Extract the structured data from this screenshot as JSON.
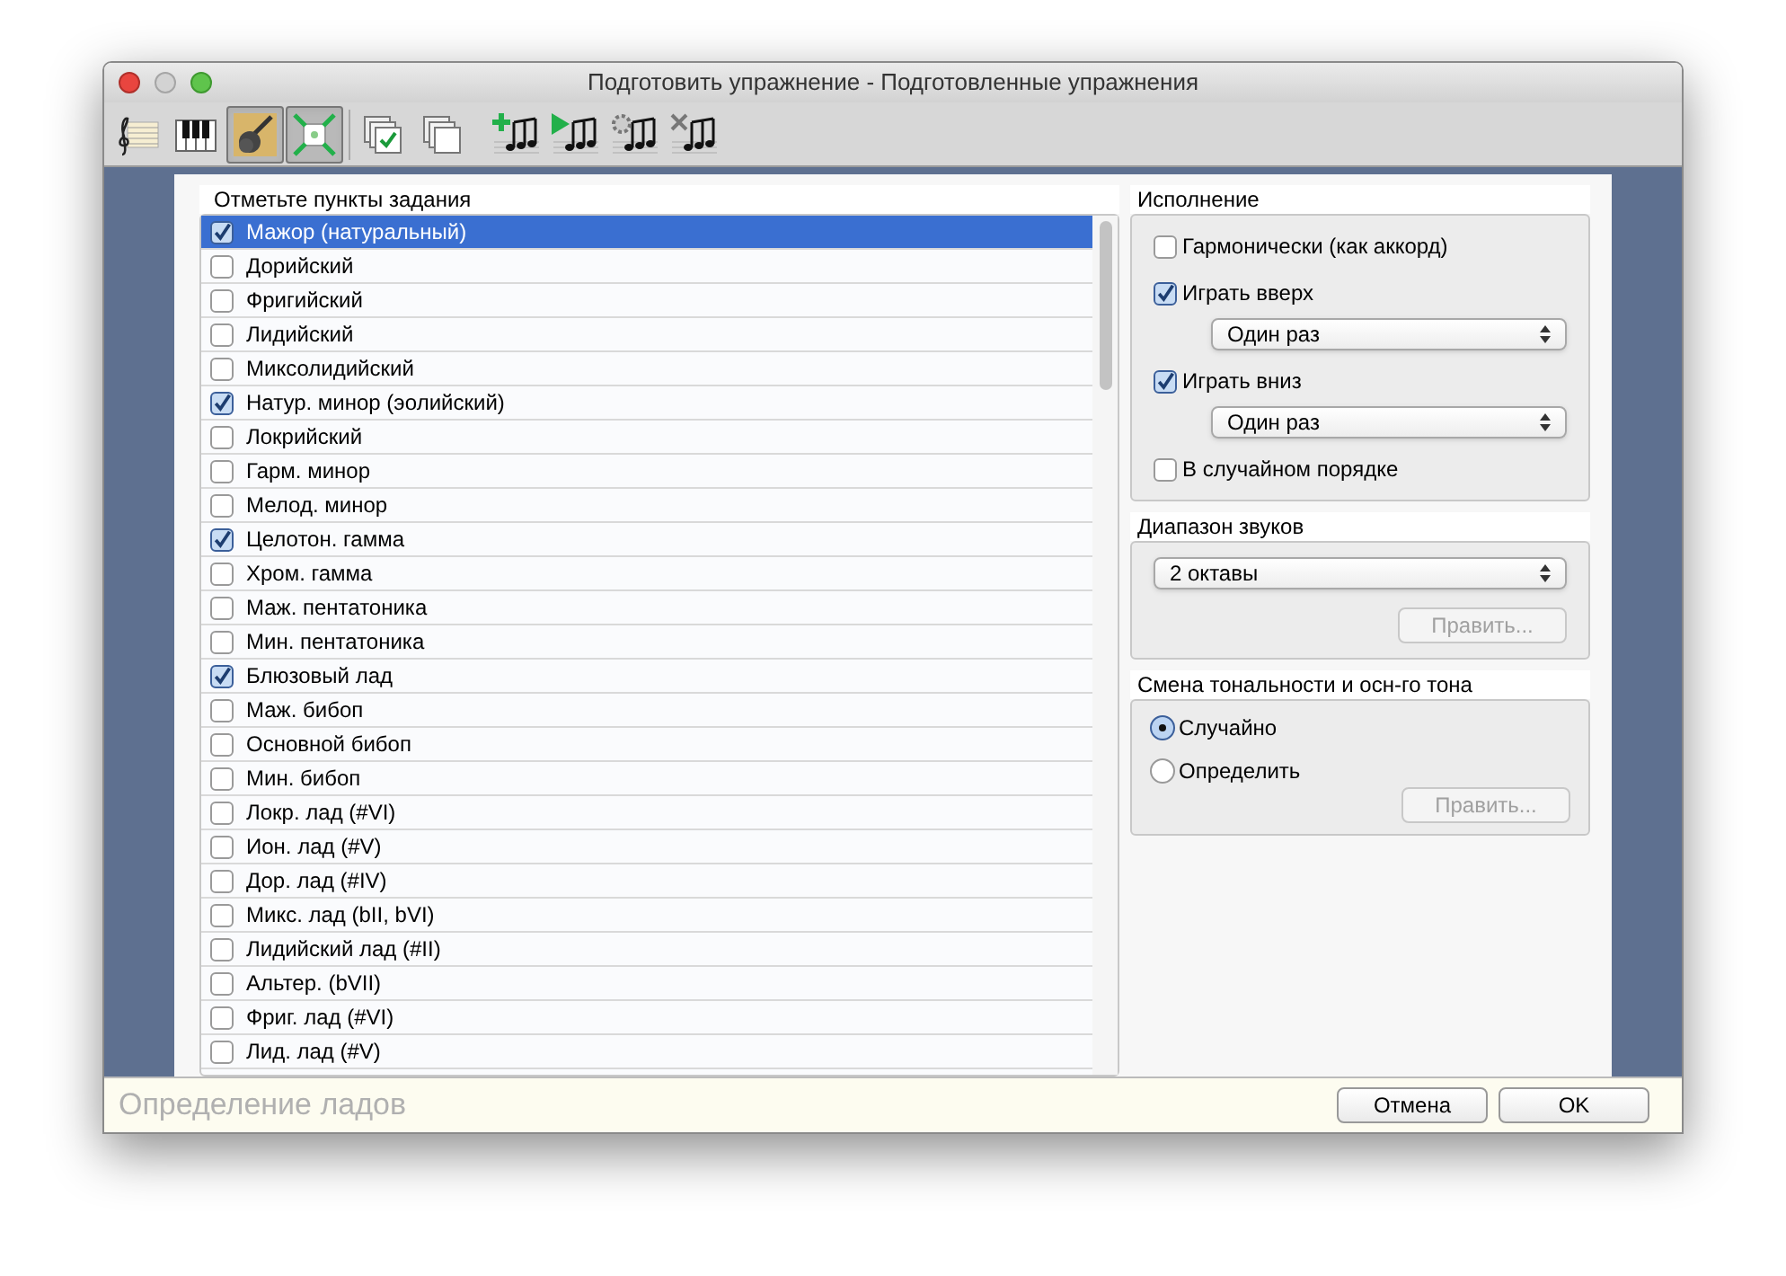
{
  "window": {
    "title": "Подготовить упражнение - Подготовленные упражнения"
  },
  "toolbar": [
    {
      "selected": false
    },
    {
      "selected": false
    },
    {
      "selected": true
    },
    {
      "selected": true
    },
    {
      "selected": false
    },
    {
      "selected": false
    },
    {
      "selected": false
    },
    {
      "selected": false
    },
    {
      "selected": false
    },
    {
      "selected": false
    }
  ],
  "task_list": {
    "title": "Отметьте пункты задания",
    "items": [
      {
        "label": "Мажор (натуральный)",
        "checked": true,
        "selected": true
      },
      {
        "label": "Дорийский",
        "checked": false,
        "selected": false
      },
      {
        "label": "Фригийский",
        "checked": false,
        "selected": false
      },
      {
        "label": "Лидийский",
        "checked": false,
        "selected": false
      },
      {
        "label": "Миксолидийский",
        "checked": false,
        "selected": false
      },
      {
        "label": "Натур. минор (эолийский)",
        "checked": true,
        "selected": false
      },
      {
        "label": "Локрийский",
        "checked": false,
        "selected": false
      },
      {
        "label": "Гарм. минор",
        "checked": false,
        "selected": false
      },
      {
        "label": "Мелод. минор",
        "checked": false,
        "selected": false
      },
      {
        "label": "Целотон. гамма",
        "checked": true,
        "selected": false
      },
      {
        "label": "Хром. гамма",
        "checked": false,
        "selected": false
      },
      {
        "label": "Маж. пентатоника",
        "checked": false,
        "selected": false
      },
      {
        "label": "Мин. пентатоника",
        "checked": false,
        "selected": false
      },
      {
        "label": "Блюзовый лад",
        "checked": true,
        "selected": false
      },
      {
        "label": "Маж. бибоп",
        "checked": false,
        "selected": false
      },
      {
        "label": "Основной бибоп",
        "checked": false,
        "selected": false
      },
      {
        "label": "Мин. бибоп",
        "checked": false,
        "selected": false
      },
      {
        "label": "Локр. лад (#VI)",
        "checked": false,
        "selected": false
      },
      {
        "label": "Ион. лад (#V)",
        "checked": false,
        "selected": false
      },
      {
        "label": "Дор. лад (#IV)",
        "checked": false,
        "selected": false
      },
      {
        "label": "Микс. лад (bII, bVI)",
        "checked": false,
        "selected": false
      },
      {
        "label": "Лидийский лад (#II)",
        "checked": false,
        "selected": false
      },
      {
        "label": "Альтер. (bVII)",
        "checked": false,
        "selected": false
      },
      {
        "label": "Фриг. лад (#VI)",
        "checked": false,
        "selected": false
      },
      {
        "label": "Лид. лад (#V)",
        "checked": false,
        "selected": false
      }
    ]
  },
  "performance": {
    "title": "Исполнение",
    "items": [
      {
        "kind": "checkbox",
        "label": "Гармонически (как аккорд)",
        "checked": false
      },
      {
        "kind": "checkbox",
        "label": "Играть вверх",
        "checked": true
      },
      {
        "kind": "select",
        "value": "Один раз"
      },
      {
        "kind": "checkbox",
        "label": "Играть вниз",
        "checked": true
      },
      {
        "kind": "select",
        "value": "Один раз"
      },
      {
        "kind": "checkbox",
        "label": "В случайном порядке",
        "checked": false
      }
    ]
  },
  "range": {
    "title": "Диапазон звуков",
    "value": "2 октавы",
    "edit_button": {
      "label": "Править...",
      "disabled": true
    }
  },
  "key_change": {
    "title": "Смена тональности и осн-го тона",
    "options": [
      {
        "label": "Случайно",
        "selected": true
      },
      {
        "label": "Определить",
        "selected": false
      }
    ],
    "edit_button": {
      "label": "Править...",
      "disabled": true
    }
  },
  "status_bar": {
    "text": "Определение ладов"
  },
  "buttons": [
    {
      "label": "Отмена"
    },
    {
      "label": "OK"
    }
  ]
}
